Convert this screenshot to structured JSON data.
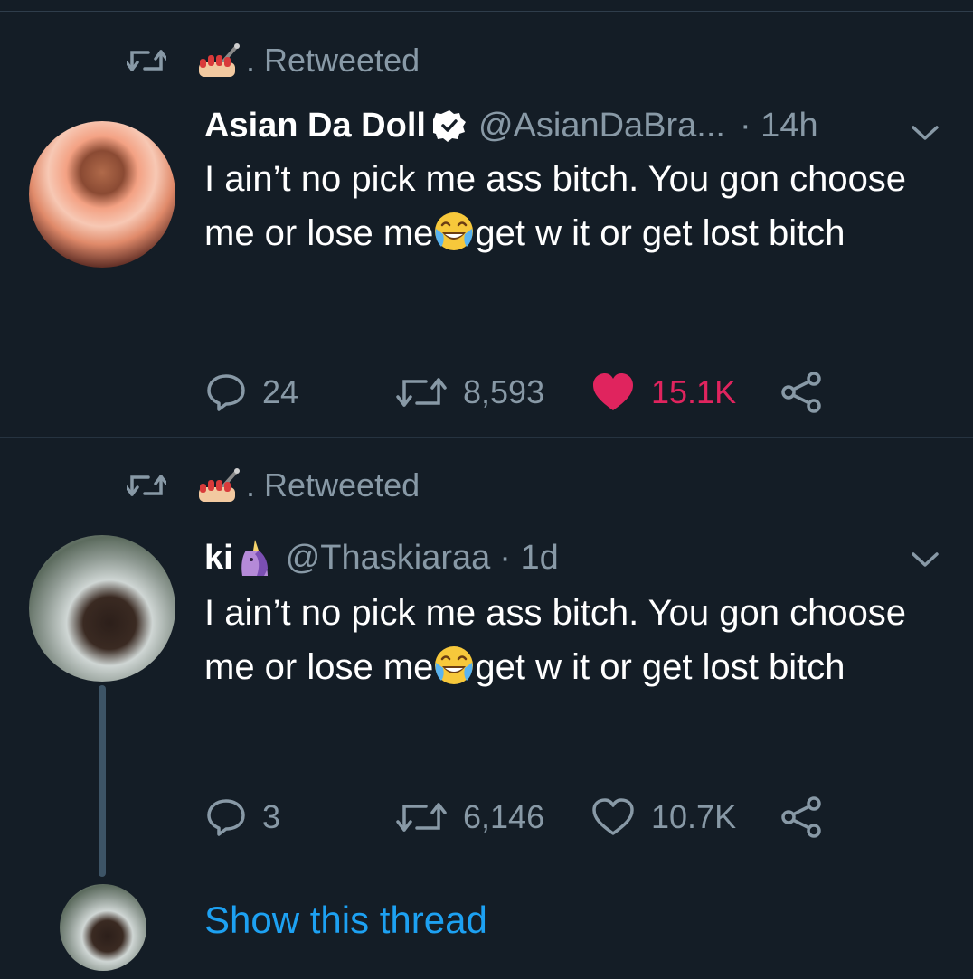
{
  "tweets": [
    {
      "retweeted_label": ". Retweeted",
      "name": "Asian Da Doll",
      "verified": true,
      "handle": "@AsianDaBra...",
      "time": "· 14h",
      "text_before_emoji": "I ain’t no pick me ass bitch. You gon choose me or lose me",
      "emoji": "face-with-tears-of-joy",
      "text_after_emoji": "get w it or get lost bitch",
      "replies": "24",
      "retweets": "8,593",
      "likes": "15.1K",
      "liked": true
    },
    {
      "retweeted_label": ". Retweeted",
      "name": "ki",
      "name_emoji": "unicorn",
      "verified": false,
      "handle": "@Thaskiaraa",
      "time": "· 1d",
      "text_before_emoji": "I ain’t no pick me ass bitch. You gon choose me or lose me",
      "emoji": "face-with-tears-of-joy",
      "text_after_emoji": "get w it or get lost bitch",
      "replies": "3",
      "retweets": "6,146",
      "likes": "10.7K",
      "liked": false
    }
  ],
  "show_thread": "Show this thread",
  "colors": {
    "background": "#141d26",
    "secondary_text": "#8899a6",
    "like_red": "#e0245e",
    "link_blue": "#1da1f2"
  }
}
